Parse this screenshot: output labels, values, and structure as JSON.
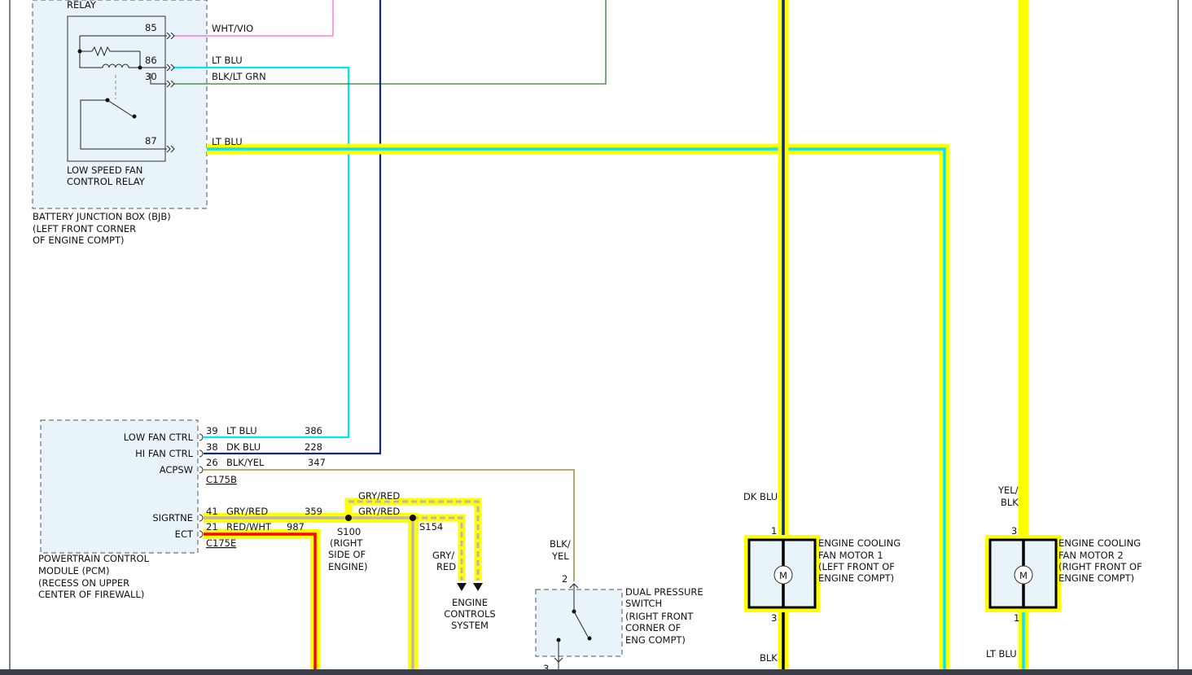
{
  "colors": {
    "yellow_highlight": "#ffff00",
    "wht_vio": "#ff66cc",
    "lt_blu": "#00e5ff",
    "dk_blu": "#0a2c7a",
    "blk_lt_grn": "#2e7d32",
    "blk_yel": "#8a7a2a",
    "gry_red": "#b8b8b8",
    "red": "#ff0000",
    "blk": "#000000",
    "component_fill": "#e8f3fa"
  },
  "relay": {
    "top_label": "RELAY",
    "name_line1": "LOW SPEED FAN",
    "name_line2": "CONTROL RELAY",
    "pins": {
      "p85": {
        "pin": "85",
        "wire": "WHT/VIO"
      },
      "p86": {
        "pin": "86",
        "wire": "LT BLU"
      },
      "p30": {
        "pin": "30",
        "wire": "BLK/LT GRN"
      },
      "p87": {
        "pin": "87",
        "wire": "LT BLU"
      }
    }
  },
  "bjb": {
    "line1": "BATTERY JUNCTION BOX (BJB)",
    "line2": "(LEFT FRONT CORNER",
    "line3": "OF ENGINE COMPT)"
  },
  "pcm": {
    "line1": "POWERTRAIN CONTROL",
    "line2": "MODULE (PCM)",
    "line3": "(RECESS ON UPPER",
    "line4": "CENTER OF FIREWALL)",
    "connector_c175b": "C175B",
    "connector_c175e": "C175E",
    "pins": [
      {
        "signal": "LOW FAN CTRL",
        "pin": "39",
        "wire": "LT BLU",
        "circuit": "386"
      },
      {
        "signal": "HI FAN CTRL",
        "pin": "38",
        "wire": "DK BLU",
        "circuit": "228"
      },
      {
        "signal": "ACPSW",
        "pin": "26",
        "wire": "BLK/YEL",
        "circuit": "347"
      },
      {
        "signal": "SIGRTNE",
        "pin": "41",
        "wire": "GRY/RED",
        "circuit": "359"
      },
      {
        "signal": "ECT",
        "pin": "21",
        "wire": "RED/WHT",
        "circuit": "987"
      }
    ]
  },
  "splices": {
    "s100": {
      "name": "S100",
      "line1": "(RIGHT",
      "line2": "SIDE OF",
      "line3": "ENGINE)"
    },
    "s154": {
      "name": "S154"
    },
    "wire_upper": "GRY/RED",
    "wire_lower": "GRY/RED",
    "drop_wire_line1": "GRY/",
    "drop_wire_line2": "RED",
    "ecs_line1": "ENGINE",
    "ecs_line2": "CONTROLS",
    "ecs_line3": "SYSTEM"
  },
  "pressure_switch": {
    "line1": "DUAL PRESSURE",
    "line2": "SWITCH",
    "line3": "(RIGHT FRONT",
    "line4": "CORNER OF",
    "line5": "ENG COMPT)",
    "pin_top": "2",
    "pin_bottom": "3",
    "wire_line1": "BLK/",
    "wire_line2": "YEL"
  },
  "fan_motor_1": {
    "line1": "ENGINE COOLING",
    "line2": "FAN MOTOR 1",
    "line3": "(LEFT FRONT OF",
    "line4": "ENGINE COMPT)",
    "symbol": "M",
    "pin_top": "1",
    "pin_bottom": "3",
    "wire_top": "DK BLU",
    "wire_bottom": "BLK"
  },
  "fan_motor_2": {
    "line1": "ENGINE COOLING",
    "line2": "FAN MOTOR 2",
    "line3": "(RIGHT FRONT OF",
    "line4": "ENGINE COMPT)",
    "symbol": "M",
    "pin_top": "3",
    "pin_bottom": "1",
    "wire_top_line1": "YEL/",
    "wire_top_line2": "BLK",
    "wire_bottom": "LT BLU"
  }
}
